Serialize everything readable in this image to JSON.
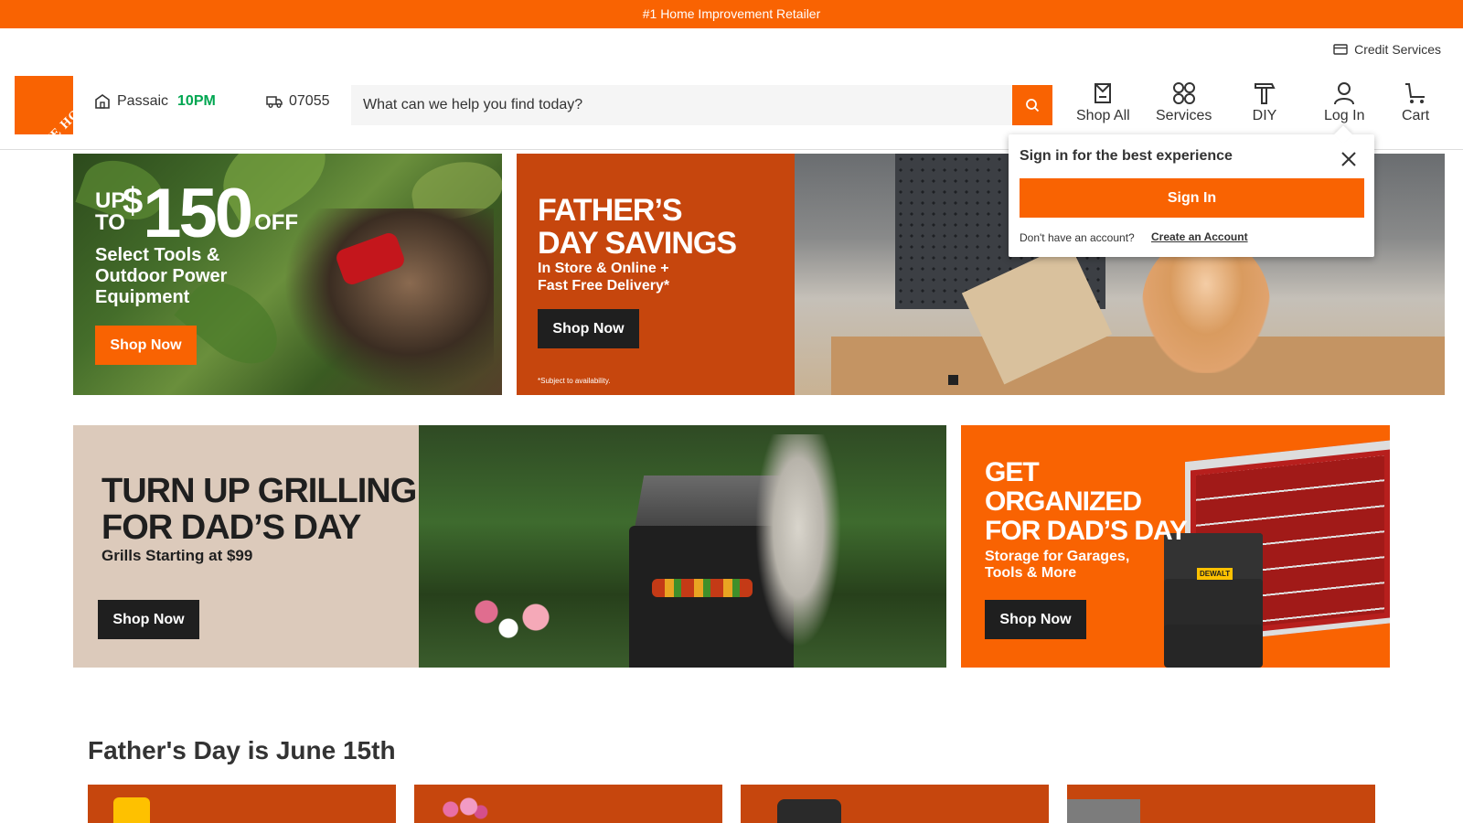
{
  "topbar": {
    "text": "#1 Home Improvement Retailer"
  },
  "header": {
    "credit_services": "Credit Services",
    "logo_text": "THE HOME DEPOT",
    "store": {
      "name": "Passaic",
      "hours": "10PM"
    },
    "zip": "07055",
    "search": {
      "placeholder": "What can we help you find today?"
    },
    "nav": {
      "shop_all": "Shop All",
      "services": "Services",
      "diy": "DIY",
      "log_in": "Log In",
      "cart": "Cart"
    }
  },
  "popover": {
    "title": "Sign in for the best experience",
    "sign_in": "Sign In",
    "no_account": "Don't have an account?",
    "create_account": "Create an Account"
  },
  "hero1": {
    "up_to": "UP TO",
    "dollar": "$",
    "amount": "150",
    "off": "OFF",
    "sub": "Select Tools & Outdoor Power Equipment",
    "button": "Shop Now"
  },
  "hero2": {
    "title_line1": "FATHER’S",
    "title_line2": "DAY SAVINGS",
    "sub_line1": "In Store & Online +",
    "sub_line2": "Fast Free Delivery*",
    "button": "Shop Now",
    "fine_print": "*Subject to availability."
  },
  "grill": {
    "title_line1": "TURN UP GRILLING",
    "title_line2": "FOR DAD’S DAY",
    "sub": "Grills Starting at $99",
    "button": "Shop Now"
  },
  "organize": {
    "title_line1": "GET",
    "title_line2": "ORGANIZED",
    "title_line3": "FOR DAD’S DAY",
    "sub_line1": "Storage for Garages,",
    "sub_line2": "Tools & More",
    "button": "Shop Now"
  },
  "section": {
    "title": "Father's Day is June 15th"
  },
  "colors": {
    "brand_orange": "#f96302",
    "dark_orange": "#c6460d",
    "store_hours_green": "#00a651",
    "button_dark": "#1f1f1f"
  },
  "icons": [
    "credit-card-icon",
    "store-icon",
    "truck-icon",
    "search-icon",
    "shop-all-icon",
    "services-icon",
    "diy-hammer-icon",
    "user-icon",
    "cart-icon",
    "close-icon"
  ]
}
